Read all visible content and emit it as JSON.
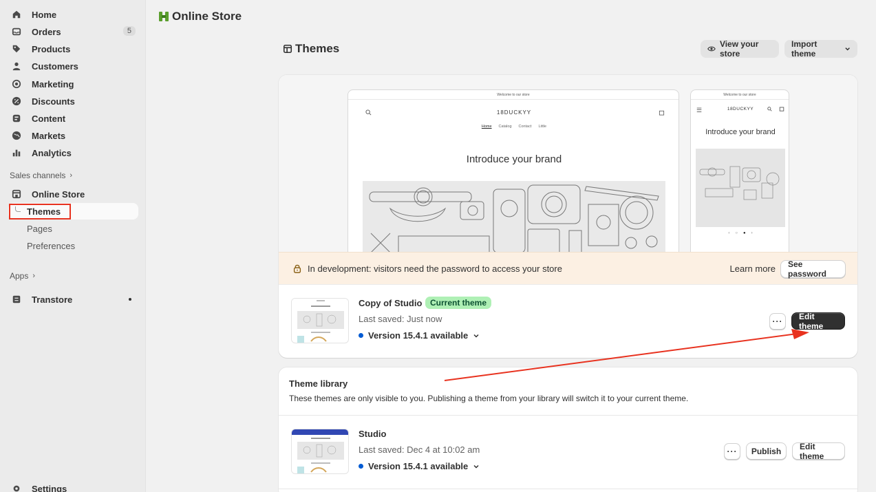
{
  "sidebar": {
    "items": [
      {
        "label": "Home",
        "icon": "home-icon"
      },
      {
        "label": "Orders",
        "icon": "orders-icon",
        "count": "5"
      },
      {
        "label": "Products",
        "icon": "tag-icon"
      },
      {
        "label": "Customers",
        "icon": "person-icon"
      },
      {
        "label": "Marketing",
        "icon": "target-icon"
      },
      {
        "label": "Discounts",
        "icon": "discount-icon"
      },
      {
        "label": "Content",
        "icon": "content-icon"
      },
      {
        "label": "Markets",
        "icon": "globe-icon"
      },
      {
        "label": "Analytics",
        "icon": "bar-chart-icon"
      }
    ],
    "sales_channels_label": "Sales channels",
    "online_store_label": "Online Store",
    "sub_items": [
      "Themes",
      "Pages",
      "Preferences"
    ],
    "apps_label": "Apps",
    "app_item": "Transtore",
    "settings_label": "Settings"
  },
  "topbar": {
    "title": "Online Store"
  },
  "page": {
    "title": "Themes",
    "view_store_label": "View your store",
    "import_theme_label": "Import theme"
  },
  "preview": {
    "announcement": "Welcome to our store",
    "store_name": "18DUCKYY",
    "nav_links": [
      "Home",
      "Catalog",
      "Contact",
      "Little"
    ],
    "headline": "Introduce your brand"
  },
  "dev_banner": {
    "message": "In development: visitors need the password to access your store",
    "learn_more": "Learn more",
    "see_password": "See password"
  },
  "current_theme": {
    "name": "Copy of Studio",
    "badge": "Current theme",
    "last_saved": "Last saved: Just now",
    "version": "Version 15.4.1 available",
    "more_label": "···",
    "edit_label": "Edit theme"
  },
  "library": {
    "title": "Theme library",
    "description": "These themes are only visible to you. Publishing a theme from your library will switch it to your current theme.",
    "themes": [
      {
        "name": "Studio",
        "last_saved": "Last saved: Dec 4 at 10:02 am",
        "version": "Version 15.4.1 available",
        "more_label": "···",
        "publish_label": "Publish",
        "edit_label": "Edit theme"
      }
    ]
  },
  "colors": {
    "annotation_red": "#e8321f",
    "badge_green": "#aff0b5",
    "dark_button": "#303030",
    "version_dot": "#005bd3"
  }
}
